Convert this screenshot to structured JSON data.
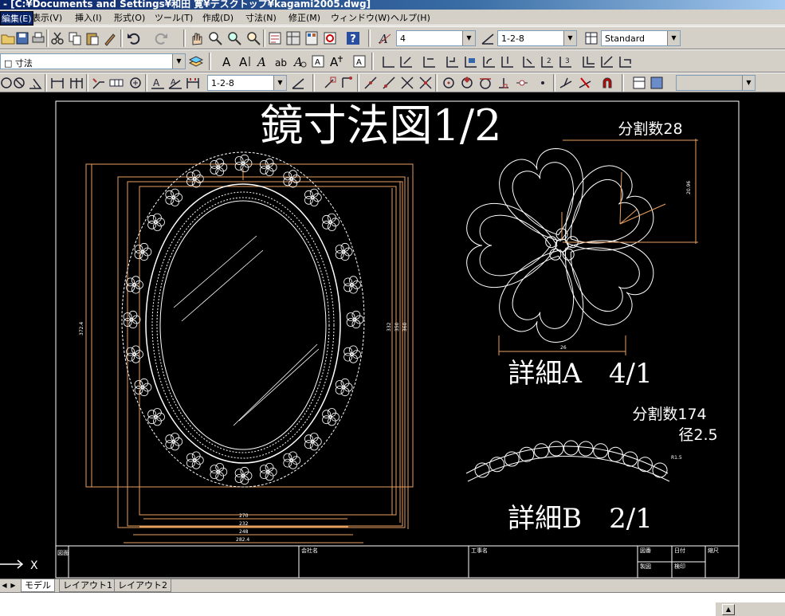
{
  "window": {
    "title": "- [C:¥Documents and Settings¥和田 寛¥デスクトップ¥kagami2005.dwg]"
  },
  "menu": [
    {
      "label": "編集(E)",
      "active": true
    },
    {
      "label": "表示(V)"
    },
    {
      "label": "挿入(I)"
    },
    {
      "label": "形式(O)"
    },
    {
      "label": "ツール(T)"
    },
    {
      "label": "作成(D)"
    },
    {
      "label": "寸法(N)"
    },
    {
      "label": "修正(M)"
    },
    {
      "label": "ウィンドウ(W)"
    },
    {
      "label": "ヘルプ(H)"
    }
  ],
  "toolbar": {
    "text_style_value": "4",
    "dim_style_value": "1-2-8",
    "table_style_value": "Standard",
    "layer_value": "寸法",
    "dim_style2_value": "1-2-8",
    "disabled_combo_value": ""
  },
  "icons": {
    "row1": [
      "open-icon",
      "save-icon",
      "print-icon",
      "cut-icon",
      "copy-icon",
      "paste-icon",
      "match-properties-icon",
      "undo-icon",
      "redo-icon",
      "pan-icon",
      "zoom-realtime-icon",
      "zoom-window-icon",
      "zoom-previous-icon",
      "properties-icon",
      "design-center-icon",
      "tool-palettes-icon",
      "markup-icon",
      "help-icon"
    ],
    "row2": [
      "text-icon",
      "multiline-text-icon",
      "single-line-text-icon",
      "edit-text-icon",
      "find-text-icon",
      "scale-text-icon",
      "justify-text-icon",
      "convert-text-icon",
      "linear-dim-icon",
      "aligned-dim-icon",
      "ordinate-dim-icon",
      "radius-dim-icon",
      "diameter-dim-icon",
      "angular-dim-icon",
      "quick-dim-icon",
      "baseline-dim-icon",
      "continue-dim-icon",
      "leader-icon",
      "tolerance-icon",
      "center-mark-icon"
    ],
    "row3": [
      "circle-icon",
      "arc-icon",
      "dim-update-icon",
      "dim-edit-icon",
      "dim-text-edit-icon",
      "ucs-icon",
      "osnap-endpoint-icon",
      "osnap-midpoint-icon",
      "osnap-intersection-icon",
      "osnap-apparent-icon",
      "osnap-center-icon",
      "osnap-quadrant-icon",
      "osnap-tangent-icon",
      "osnap-perpendicular-icon",
      "osnap-node-icon",
      "osnap-nearest-icon",
      "osnap-none-icon",
      "osnap-settings-icon",
      "layer-icon",
      "layer-previous-icon"
    ]
  },
  "drawing": {
    "title": "鏡寸法図1/2",
    "detail_a": {
      "label": "詳細A　4/1",
      "division": "分割数28"
    },
    "detail_b": {
      "label": "詳細B　2/1",
      "division": "分割数174",
      "diameter": "径2.5"
    },
    "dims": {
      "w1": "270",
      "w2": "232",
      "w3": "248",
      "w4": "282.4",
      "h1": "372.4",
      "h2": "332",
      "h3": "350",
      "h4": "360",
      "flower_w": "26",
      "flower_h": "20.96",
      "bead": "R1.5"
    },
    "title_block": {
      "c1": "会社名",
      "c2": "工事名",
      "c3": "図番",
      "c4": "日付",
      "c5": "縮尺",
      "c6": "図面",
      "c7": "製図",
      "c8": "検印"
    },
    "ucs_label": "X"
  },
  "layout_tabs": [
    "モデル",
    "レイアウト1",
    "レイアウト2"
  ]
}
